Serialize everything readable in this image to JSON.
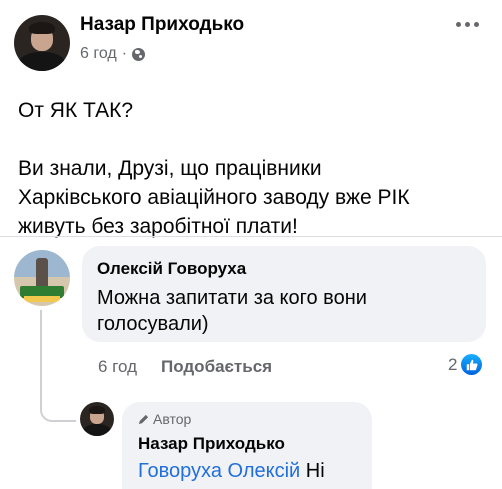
{
  "post": {
    "author": "Назар Приходько",
    "time": "6 год",
    "separator": "·",
    "body_line1": "От ЯК ТАК?",
    "body_line2": "Ви знали, Друзі, що працівники",
    "body_line3": "Харківського авіаційного заводу вже РІК",
    "body_line4": "живуть без заробітної плати!"
  },
  "comment": {
    "author": "Олексій Говоруха",
    "text": "Можна запитати за кого вони голосували)",
    "time": "6 год",
    "like_label": "Подобається",
    "reaction_count": "2"
  },
  "reply": {
    "badge": "Автор",
    "author": "Назар Приходько",
    "mention": "Говоруха Олексій",
    "text": " Ні"
  },
  "colors": {
    "secondary_text": "#65676b",
    "bubble_bg": "#f0f2f5",
    "mention": "#216fdb",
    "like_blue": "#1877f2"
  },
  "icons": {
    "audience": "globe-icon",
    "more": "more-options-icon",
    "reaction": "like-reaction-icon",
    "author_badge": "pencil-icon"
  }
}
